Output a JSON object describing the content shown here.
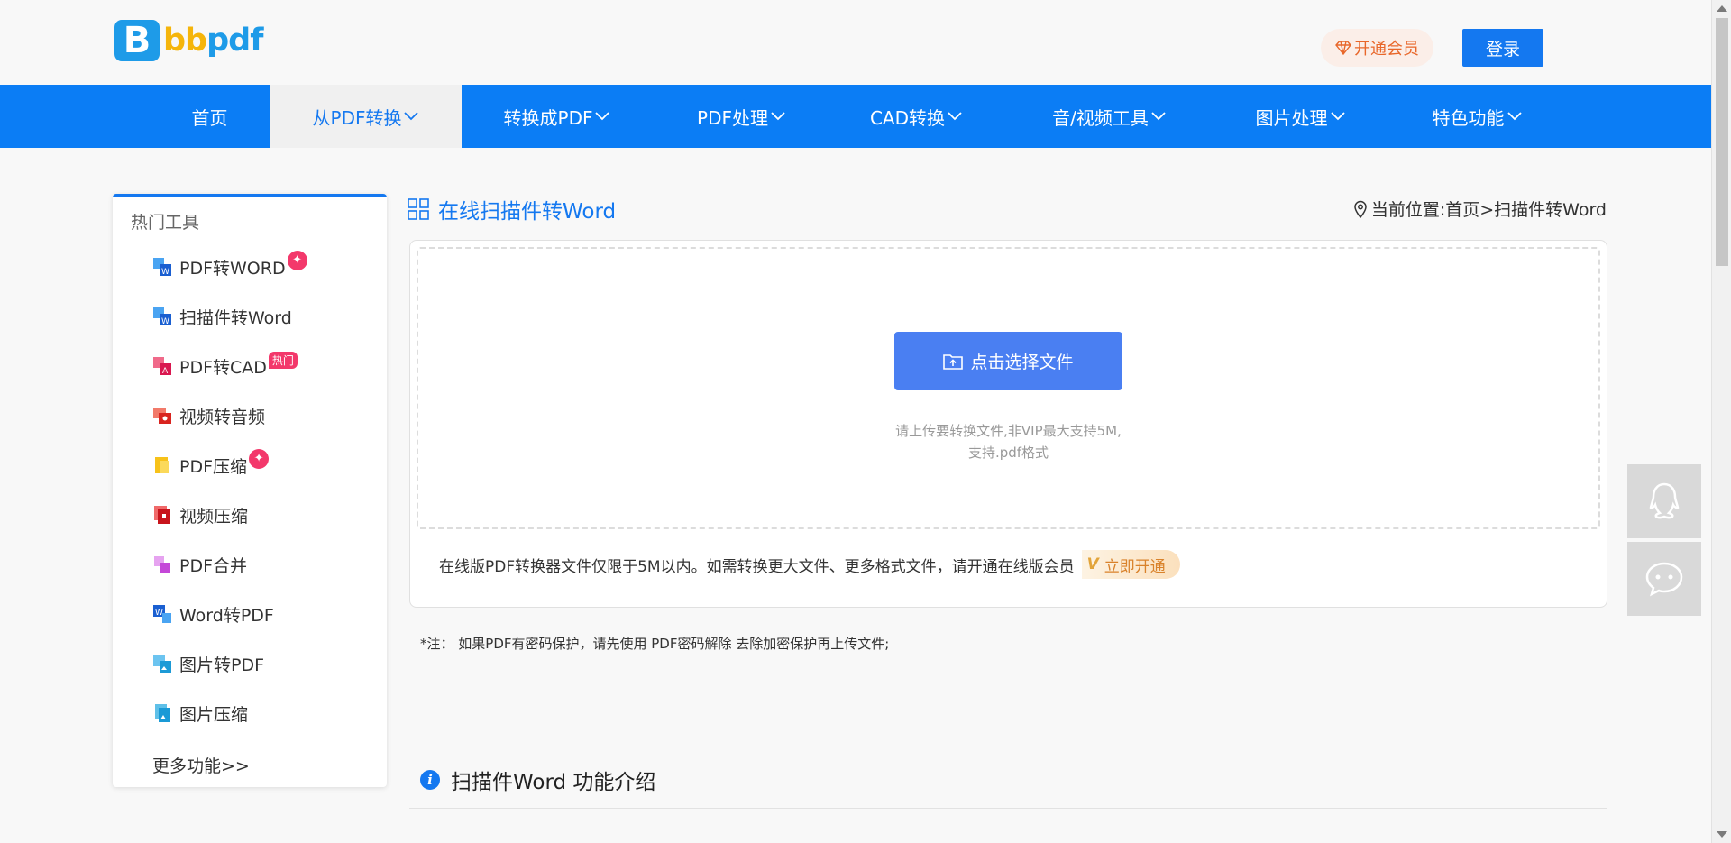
{
  "header": {
    "logo_letter": "B",
    "logo_b": "bb",
    "logo_pdf": "pdf",
    "vip_label": "开通会员",
    "login_label": "登录"
  },
  "nav": {
    "items": [
      {
        "label": "首页"
      },
      {
        "label": "从PDF转换"
      },
      {
        "label": "转换成PDF"
      },
      {
        "label": "PDF处理"
      },
      {
        "label": "CAD转换"
      },
      {
        "label": "音/视频工具"
      },
      {
        "label": "图片处理"
      },
      {
        "label": "特色功能"
      }
    ],
    "active_index": 1
  },
  "sidebar": {
    "title": "热门工具",
    "items": [
      {
        "label": "PDF转WORD",
        "icon": "pdf-to-word-icon",
        "badge": "fire"
      },
      {
        "label": "扫描件转Word",
        "icon": "scan-to-word-icon",
        "badge": ""
      },
      {
        "label": "PDF转CAD",
        "icon": "pdf-to-cad-icon",
        "badge": "热门"
      },
      {
        "label": "视频转音频",
        "icon": "video-to-audio-icon",
        "badge": ""
      },
      {
        "label": "PDF压缩",
        "icon": "pdf-compress-icon",
        "badge": "fire"
      },
      {
        "label": "视频压缩",
        "icon": "video-compress-icon",
        "badge": ""
      },
      {
        "label": "PDF合并",
        "icon": "pdf-merge-icon",
        "badge": ""
      },
      {
        "label": "Word转PDF",
        "icon": "word-to-pdf-icon",
        "badge": ""
      },
      {
        "label": "图片转PDF",
        "icon": "image-to-pdf-icon",
        "badge": ""
      },
      {
        "label": "图片压缩",
        "icon": "image-compress-icon",
        "badge": ""
      }
    ],
    "more_label": "更多功能>>"
  },
  "main": {
    "title": "在线扫描件转Word",
    "breadcrumb": "当前位置:首页>扫描件转Word",
    "select_button": "点击选择文件",
    "hint_line1": "请上传要转换文件,非VIP最大支持5M,",
    "hint_line2": "支持.pdf格式",
    "limit_text": "在线版PDF转换器文件仅限于5M以内。如需转换更大文件、更多格式文件，请开通在线版会员",
    "activate_vp": "V",
    "activate_label": "立即开通",
    "note": "*注： 如果PDF有密码保护，请先使用 PDF密码解除 去除加密保护再上传文件;",
    "intro_title": "扫描件Word 功能介绍"
  },
  "colors": {
    "primary": "#1478f0",
    "nav_bg": "#0b7df5",
    "upload_button": "#4a7ff2",
    "hot": "#f3386b",
    "vip_text": "#e8672a"
  }
}
